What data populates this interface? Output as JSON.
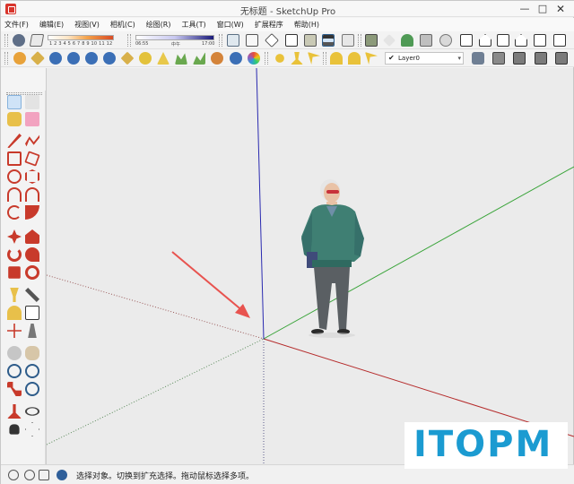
{
  "window": {
    "title": "无标题 - SketchUp Pro",
    "min_glyph": "—",
    "max_glyph": "□",
    "close_glyph": "✕"
  },
  "menu": [
    "文件(F)",
    "编辑(E)",
    "视图(V)",
    "相机(C)",
    "绘图(R)",
    "工具(T)",
    "窗口(W)",
    "扩展程序",
    "帮助(H)"
  ],
  "shadow_slider": {
    "ticks": "1 2 3 4 5 6 7 8 9 10 11 12"
  },
  "time_slider": {
    "start": "06:55",
    "mid": "中午",
    "end": "17:00"
  },
  "layer": {
    "current": "Layer0",
    "check": "✔",
    "arrow": "▾"
  },
  "status": {
    "text": "选择对象。切换到扩充选择。拖动鼠标选择多项。"
  },
  "watermark": {
    "text": "ITOPM"
  },
  "colors": {
    "axis_red": "#b52a2a",
    "axis_green": "#3aa43a",
    "axis_blue": "#2a2ab0",
    "annotation_arrow": "#e8534f",
    "viewport_bg": "#ebebeb",
    "watermark": "#1b9bd1"
  }
}
